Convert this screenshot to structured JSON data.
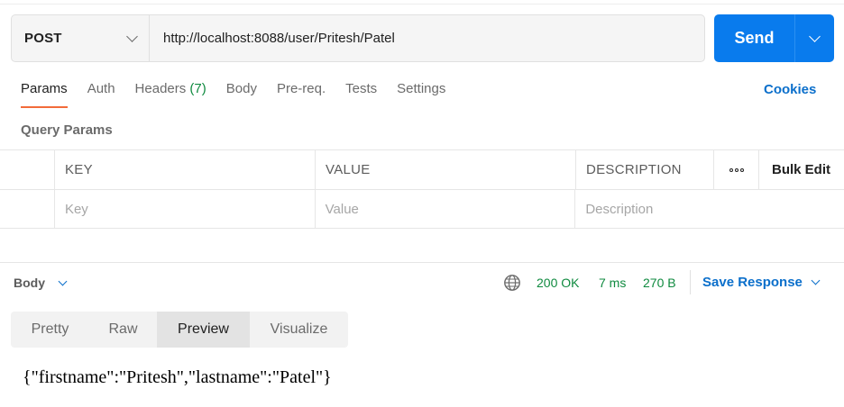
{
  "request": {
    "method": "POST",
    "url": "http://localhost:8088/user/Pritesh/Patel",
    "send_label": "Send"
  },
  "tabs": [
    {
      "label": "Params",
      "active": true
    },
    {
      "label": "Auth"
    },
    {
      "label": "Headers",
      "count": "(7)"
    },
    {
      "label": "Body"
    },
    {
      "label": "Pre-req."
    },
    {
      "label": "Tests"
    },
    {
      "label": "Settings"
    }
  ],
  "cookies_label": "Cookies",
  "query_params": {
    "title": "Query Params",
    "columns": [
      "KEY",
      "VALUE",
      "DESCRIPTION"
    ],
    "bulk_edit": "Bulk Edit",
    "placeholders": {
      "key": "Key",
      "value": "Value",
      "description": "Description"
    }
  },
  "response": {
    "body_label": "Body",
    "status": "200 OK",
    "time": "7 ms",
    "size": "270 B",
    "save_label": "Save Response",
    "views": [
      "Pretty",
      "Raw",
      "Preview",
      "Visualize"
    ],
    "active_view": "Preview",
    "preview_text": "{\"firstname\":\"Pritesh\",\"lastname\":\"Patel\"}"
  },
  "colors": {
    "accent_blue": "#097bed",
    "tab_underline": "#f26b3a",
    "status_green": "#0f8a3f",
    "link_blue": "#0b6fcb"
  }
}
